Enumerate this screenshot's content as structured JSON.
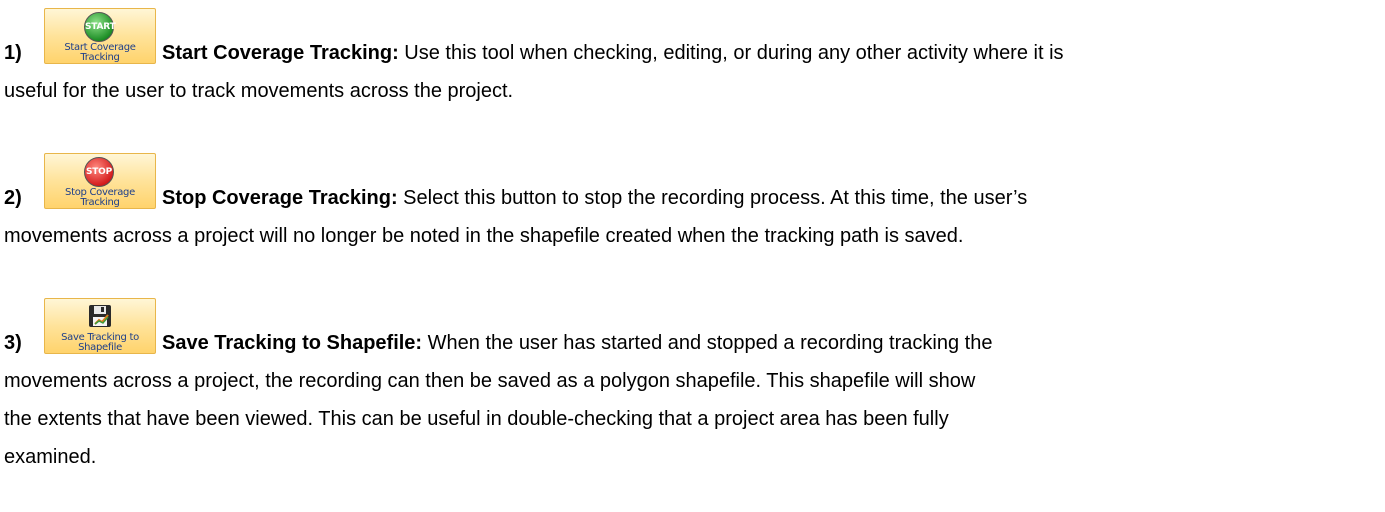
{
  "items": [
    {
      "number": "1)",
      "button": {
        "label_line1": "Start Coverage",
        "label_line2": "Tracking",
        "icon_text": "START",
        "icon": "start-icon"
      },
      "term": "Start Coverage Tracking:",
      "text_line1": " Use this tool when checking, editing, or during any other activity where it is",
      "text_rest": "useful for the user to track movements across the project."
    },
    {
      "number": "2)",
      "button": {
        "label_line1": "Stop Coverage",
        "label_line2": "Tracking",
        "icon_text": "STOP",
        "icon": "stop-icon"
      },
      "term": "Stop Coverage Tracking:",
      "text_line1": " Select this button to stop the recording process. At this time, the user’s",
      "text_rest": "movements across a project will no longer be noted in the shapefile created when the tracking path is saved."
    },
    {
      "number": "3)",
      "button": {
        "label_line1": "Save Tracking to",
        "label_line2": "Shapefile",
        "icon": "floppy-disk-icon"
      },
      "term": "Save Tracking to Shapefile:",
      "text_line1": " When the user has started and stopped a recording tracking the",
      "text_rest_lines": [
        "movements across a project, the recording can then be saved as a polygon shapefile. This shapefile will show",
        "the extents that have been viewed. This can be useful in double-checking that a project area has been fully",
        "examined."
      ]
    }
  ]
}
